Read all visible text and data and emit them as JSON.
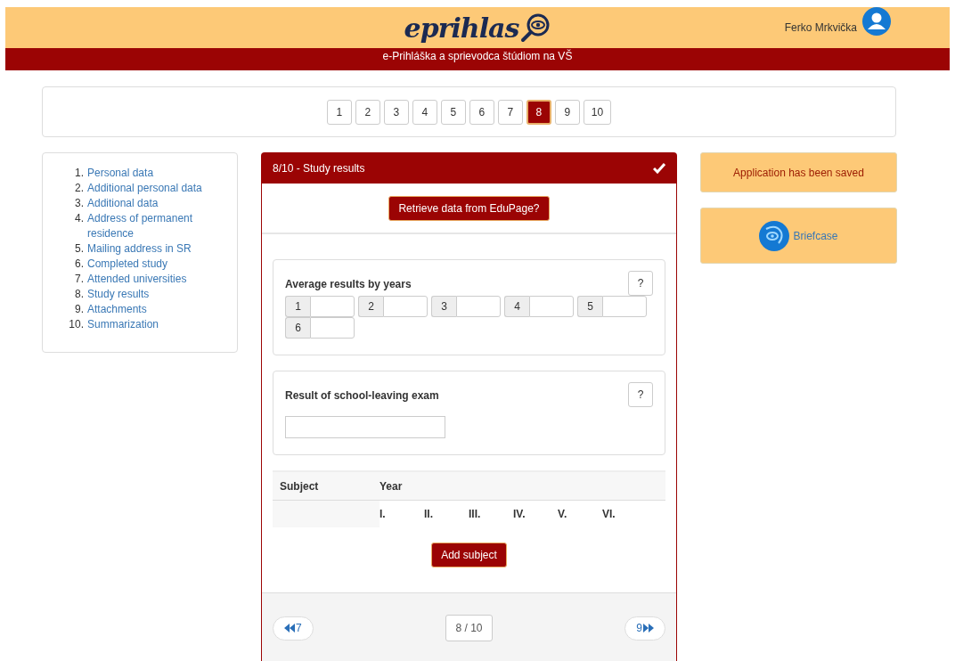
{
  "header": {
    "logo": "eprihlas",
    "user": "Ferko Mrkvička",
    "subtitle": "e-Prihláška a sprievodca štúdiom na VŠ"
  },
  "steps": [
    {
      "label": "1",
      "selected": false
    },
    {
      "label": "2",
      "selected": false
    },
    {
      "label": "3",
      "selected": false
    },
    {
      "label": "4",
      "selected": false
    },
    {
      "label": "5",
      "selected": false
    },
    {
      "label": "6",
      "selected": false
    },
    {
      "label": "7",
      "selected": false
    },
    {
      "label": "8",
      "selected": true
    },
    {
      "label": "9",
      "selected": false
    },
    {
      "label": "10",
      "selected": false
    }
  ],
  "sidebar": {
    "items": [
      {
        "number": "1.",
        "label": "Personal data"
      },
      {
        "number": "2.",
        "label": "Additional personal data"
      },
      {
        "number": "3.",
        "label": "Additional data"
      },
      {
        "number": "4.",
        "label": "Address of permanent residence"
      },
      {
        "number": "5.",
        "label": "Mailing address in SR"
      },
      {
        "number": "6.",
        "label": "Completed study"
      },
      {
        "number": "7.",
        "label": "Attended universities"
      },
      {
        "number": "8.",
        "label": "Study results"
      },
      {
        "number": "9.",
        "label": "Attachments"
      },
      {
        "number": "10.",
        "label": "Summarization"
      }
    ]
  },
  "panel": {
    "title": "8/10 - Study results",
    "completed": true,
    "retrieve_button": "Retrieve data from EduPage?",
    "average": {
      "title": "Average results by years",
      "help": "?",
      "years": [
        "1",
        "2",
        "3",
        "4",
        "5",
        "6"
      ]
    },
    "exam": {
      "title": "Result of school-leaving exam",
      "help": "?"
    },
    "table": {
      "subject_header": "Subject",
      "year_header": "Year",
      "years": [
        "I.",
        "II.",
        "III.",
        "IV.",
        "V.",
        "VI."
      ]
    },
    "add_button": "Add subject",
    "prev": "7",
    "page": "8 / 10",
    "next": "9"
  },
  "aside": {
    "status": "Application has been saved",
    "briefcase": "Briefcase"
  }
}
